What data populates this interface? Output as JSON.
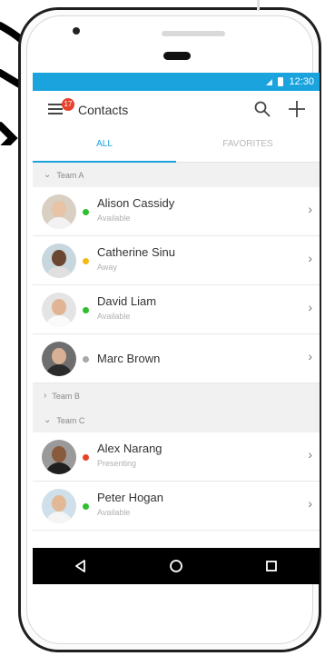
{
  "status_bar": {
    "time": "12:30"
  },
  "app_bar": {
    "title": "Contacts",
    "badge_count": "17"
  },
  "tabs": [
    {
      "label": "ALL",
      "active": true
    },
    {
      "label": "FAVORITES",
      "active": false
    }
  ],
  "groups": [
    {
      "name": "Team A",
      "expanded": true,
      "contacts": [
        {
          "name": "Alison Cassidy",
          "status": "Available",
          "presence_color": "#2dbf2d"
        },
        {
          "name": "Catherine Sinu",
          "status": "Away",
          "presence_color": "#f5b915"
        },
        {
          "name": "David Liam",
          "status": "Available",
          "presence_color": "#2dbf2d"
        },
        {
          "name": "Marc Brown",
          "status": "",
          "presence_color": "#a8a8a8"
        }
      ]
    },
    {
      "name": "Team B",
      "expanded": false,
      "contacts": []
    },
    {
      "name": "Team C",
      "expanded": true,
      "contacts": [
        {
          "name": "Alex Narang",
          "status": "Presenting",
          "presence_color": "#e8412c"
        },
        {
          "name": "Peter Hogan",
          "status": "Available",
          "presence_color": "#2dbf2d"
        }
      ]
    }
  ],
  "colors": {
    "accent": "#1aa3dd",
    "badge": "#e8412c"
  }
}
